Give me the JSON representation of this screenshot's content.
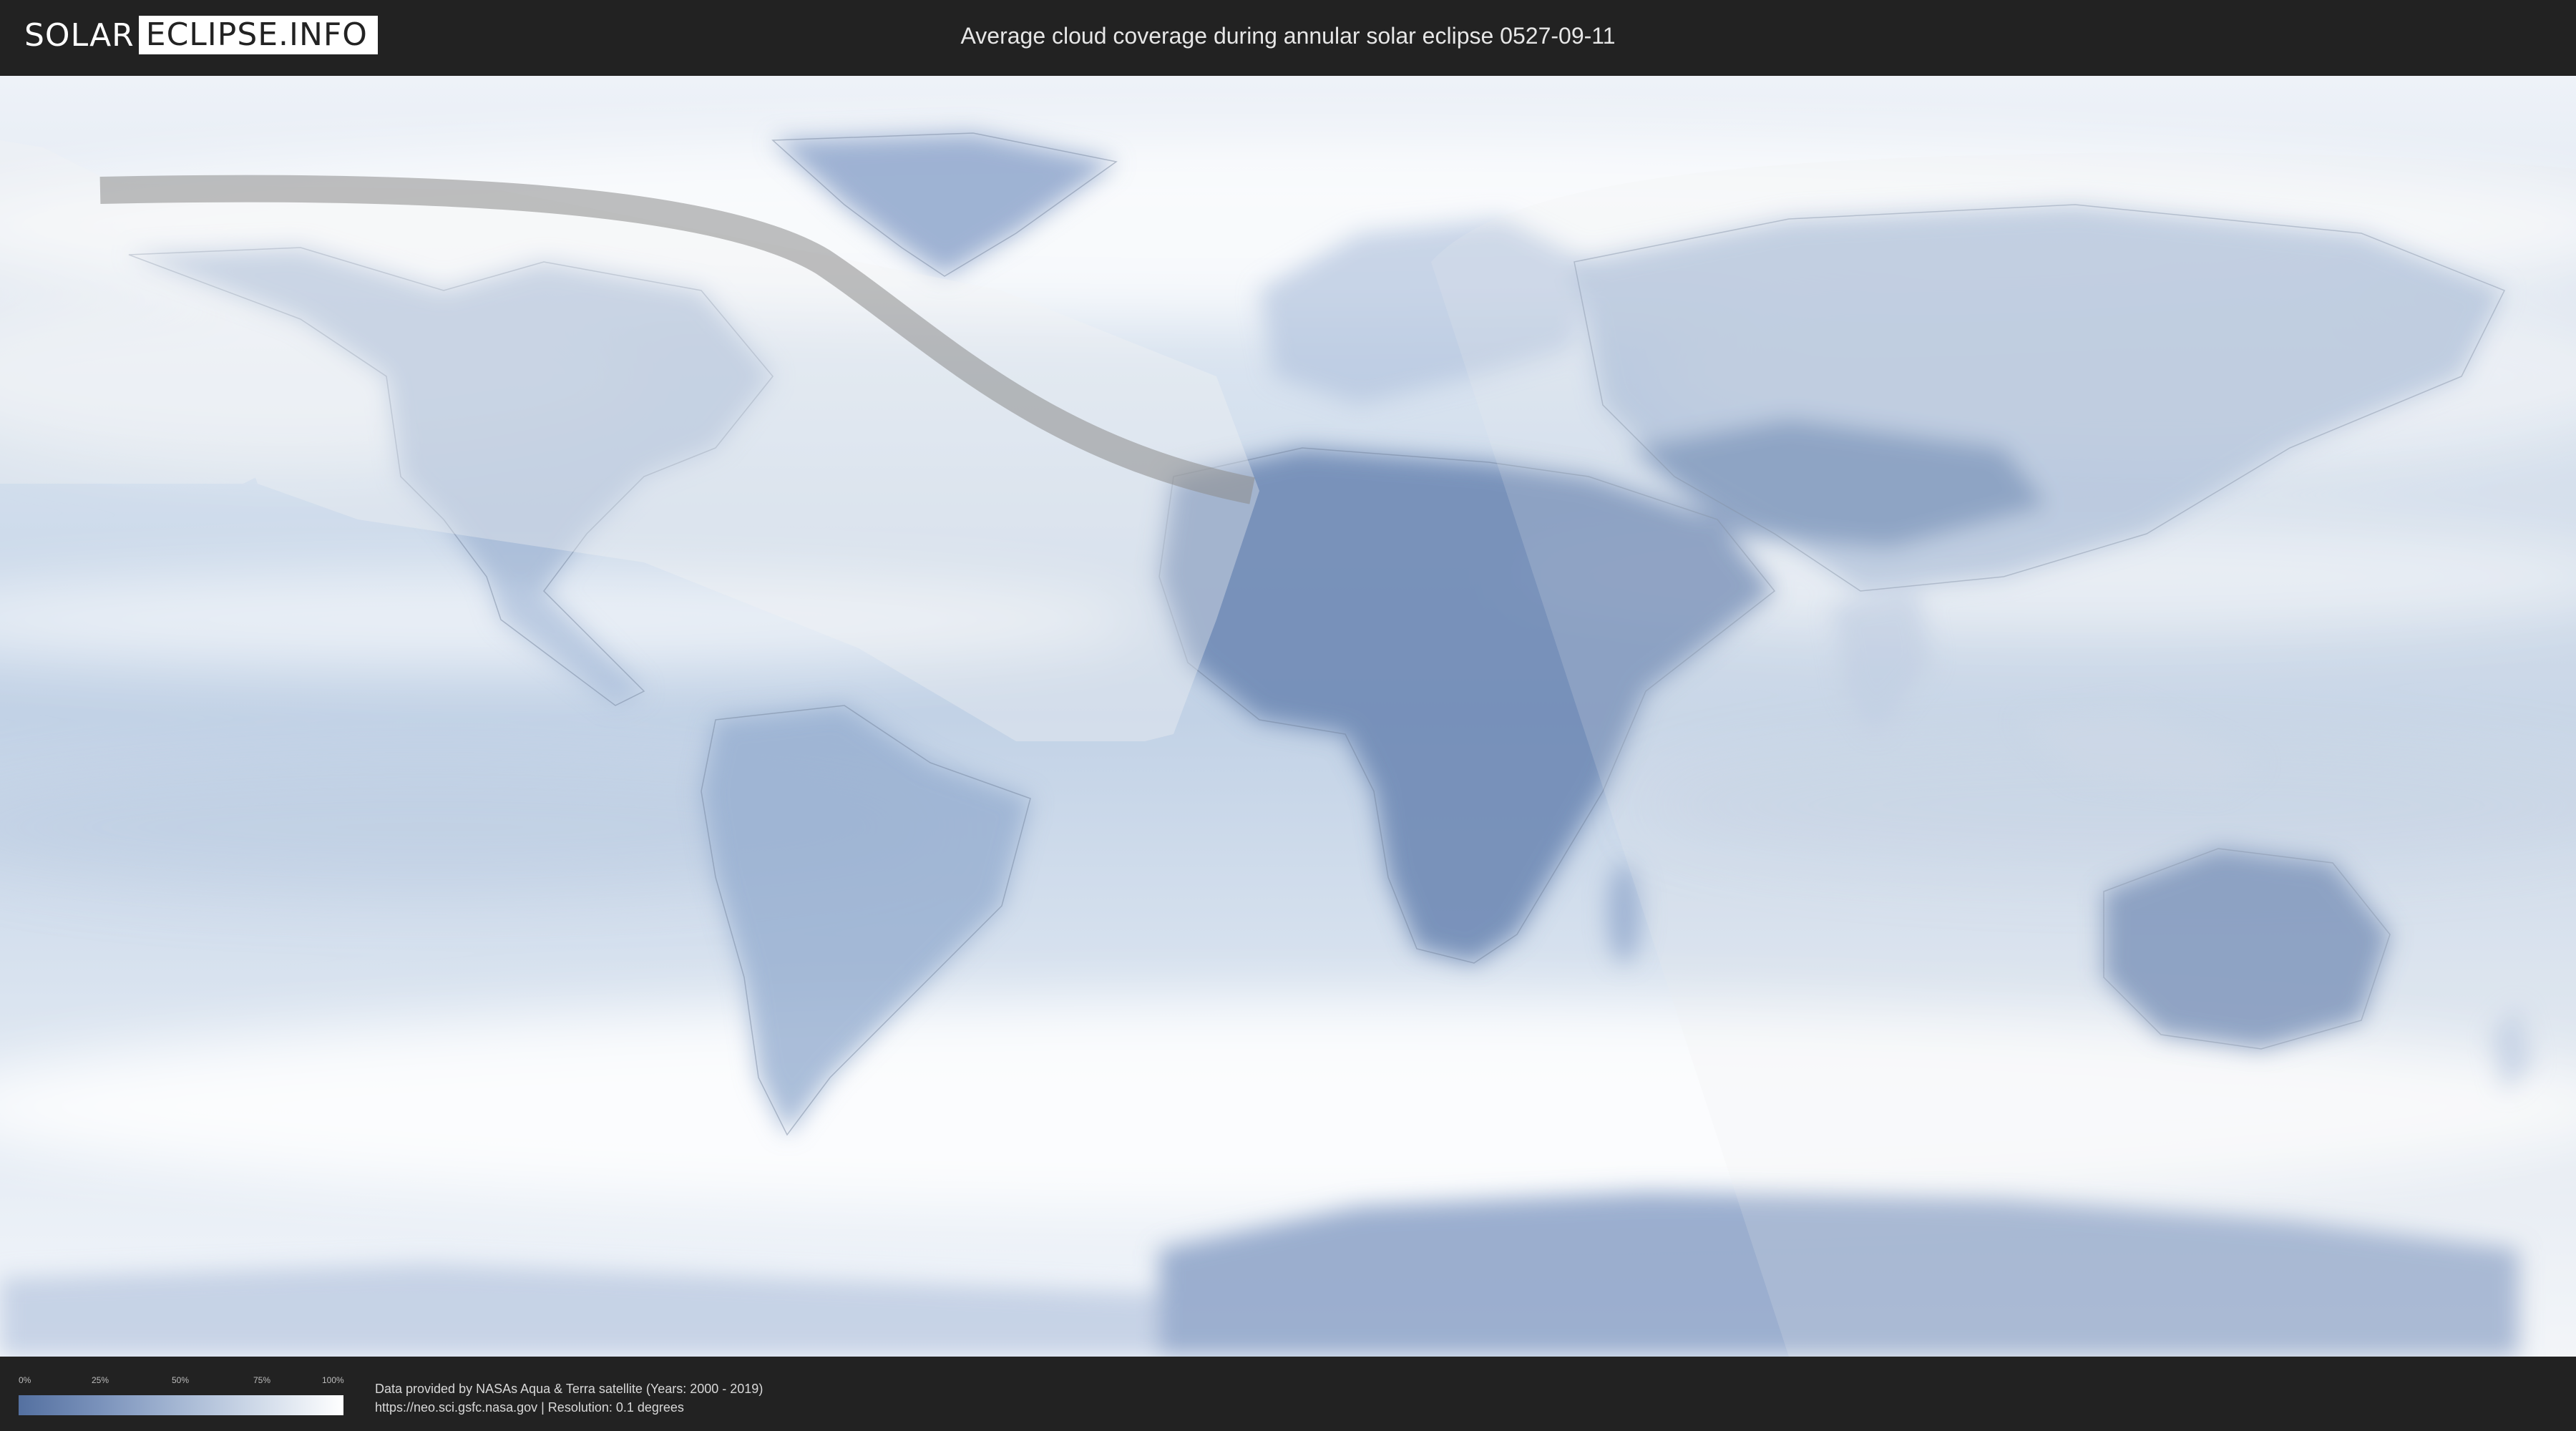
{
  "header": {
    "logo_left": "SOLAR",
    "logo_right": "ECLIPSE.INFO",
    "title": "Average cloud coverage during annular solar eclipse 0527-09-11"
  },
  "legend": {
    "ticks": [
      "0%",
      "25%",
      "50%",
      "75%",
      "100%"
    ],
    "gradient_colors": [
      "#5470a0",
      "#7a92bb",
      "#a6b8d4",
      "#d2dcea",
      "#ffffff"
    ]
  },
  "footer": {
    "credit_line_1": "Data provided by NASAs Aqua & Terra satellite (Years: 2000 - 2019)",
    "credit_line_2": "https://neo.sci.gsfc.nasa.gov | Resolution: 0.1 degrees"
  },
  "colors": {
    "background": "#222222",
    "cloud_low": "#5470a0",
    "cloud_high": "#ffffff",
    "eclipse_path": "#8c8c8c"
  }
}
